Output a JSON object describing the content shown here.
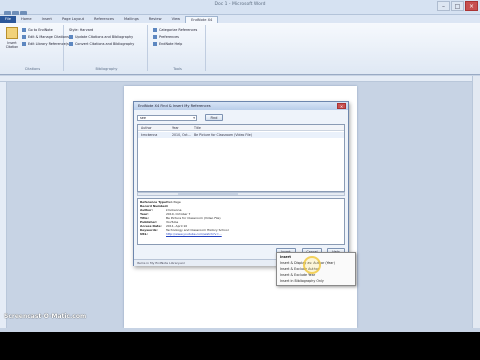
{
  "window": {
    "title": "Doc 1 - Microsoft Word",
    "minimize": "–",
    "maximize": "□",
    "close": "×"
  },
  "tabs": [
    "File",
    "Home",
    "Insert",
    "Page Layout",
    "References",
    "Mailings",
    "Review",
    "View",
    "EndNote X4"
  ],
  "ribbon": {
    "big_button_label": "Insert Citation",
    "group1_items": [
      "Go to EndNote",
      "Edit & Manage Citations",
      "Edit Library Reference(s)"
    ],
    "group1_label": "Citations",
    "group2_items": [
      "Style: Harvard",
      "Update Citations and Bibliography",
      "Convert Citations and Bibliography"
    ],
    "group2_label": "Bibliography",
    "group3_items": [
      "Categorize References",
      "Preferences",
      "EndNote Help"
    ],
    "group3_label": "Tools"
  },
  "dialog": {
    "title": "EndNote X4 Find & Insert My References",
    "search_value": "see",
    "find_button": "Find",
    "columns": [
      "Author",
      "Year",
      "Title"
    ],
    "row": {
      "author": "kmckenna",
      "year": "2010, Oct...",
      "title": "Be Picture for Classroom (Video File)"
    },
    "details": [
      {
        "label": "Reference Type:",
        "value": "Web Page"
      },
      {
        "label": "Record Number:",
        "value": "4"
      },
      {
        "label": "Author:",
        "value": "kmckenna"
      },
      {
        "label": "Year:",
        "value": "2010, October 7"
      },
      {
        "label": "Title:",
        "value": "Be Picture for Classroom (Video File)"
      },
      {
        "label": "Publisher:",
        "value": "YouTube"
      },
      {
        "label": "Access Date:",
        "value": "2011, April 10"
      },
      {
        "label": "Keywords:",
        "value": "Technology and Classroom History School"
      },
      {
        "label": "URL:",
        "value": "http://www.youtube.com/watch?v=..."
      }
    ],
    "insert_button": "Insert",
    "cancel_button": "Cancel",
    "help_button": "Help",
    "status": "Items in My EndNote Library.enl"
  },
  "menu": {
    "items": [
      "Insert",
      "Insert & Display as: Author (Year)",
      "Insert & Exclude Author",
      "Insert & Exclude Year",
      "Insert in Bibliography Only"
    ]
  },
  "watermark": "Screencast-O-Matic.com"
}
